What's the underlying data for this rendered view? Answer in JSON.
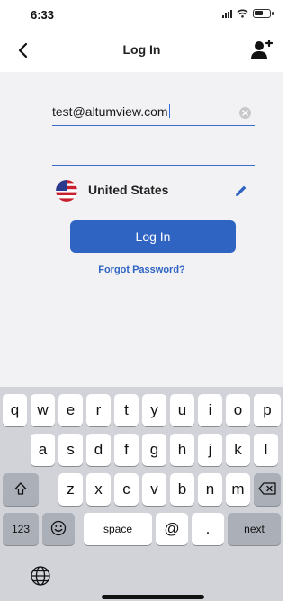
{
  "status_bar": {
    "time": "6:33",
    "battery_level": 0.6
  },
  "nav": {
    "title": "Log In",
    "back_icon": "chevron-left-icon",
    "account_icon": "person-plus-icon"
  },
  "form": {
    "email_value": "test@altumview.com",
    "password_value": "",
    "country": "United States",
    "country_flag_icon": "us-flag-icon",
    "login_label": "Log In",
    "forgot_label": "Forgot Password?"
  },
  "colors": {
    "accent": "#2f64c3",
    "background": "#f2f2f4",
    "keyboard": "#d1d3d9"
  },
  "keyboard": {
    "row1": [
      "q",
      "w",
      "e",
      "r",
      "t",
      "y",
      "u",
      "i",
      "o",
      "p"
    ],
    "row2": [
      "a",
      "s",
      "d",
      "f",
      "g",
      "h",
      "j",
      "k",
      "l"
    ],
    "row3": [
      "z",
      "x",
      "c",
      "v",
      "b",
      "n",
      "m"
    ],
    "numbers_label": "123",
    "space_label": "space",
    "at_label": "@",
    "dot_label": ".",
    "next_label": "next",
    "shift_icon": "shift-icon",
    "delete_icon": "delete-icon",
    "emoji_icon": "emoji-icon",
    "globe_icon": "globe-icon"
  }
}
